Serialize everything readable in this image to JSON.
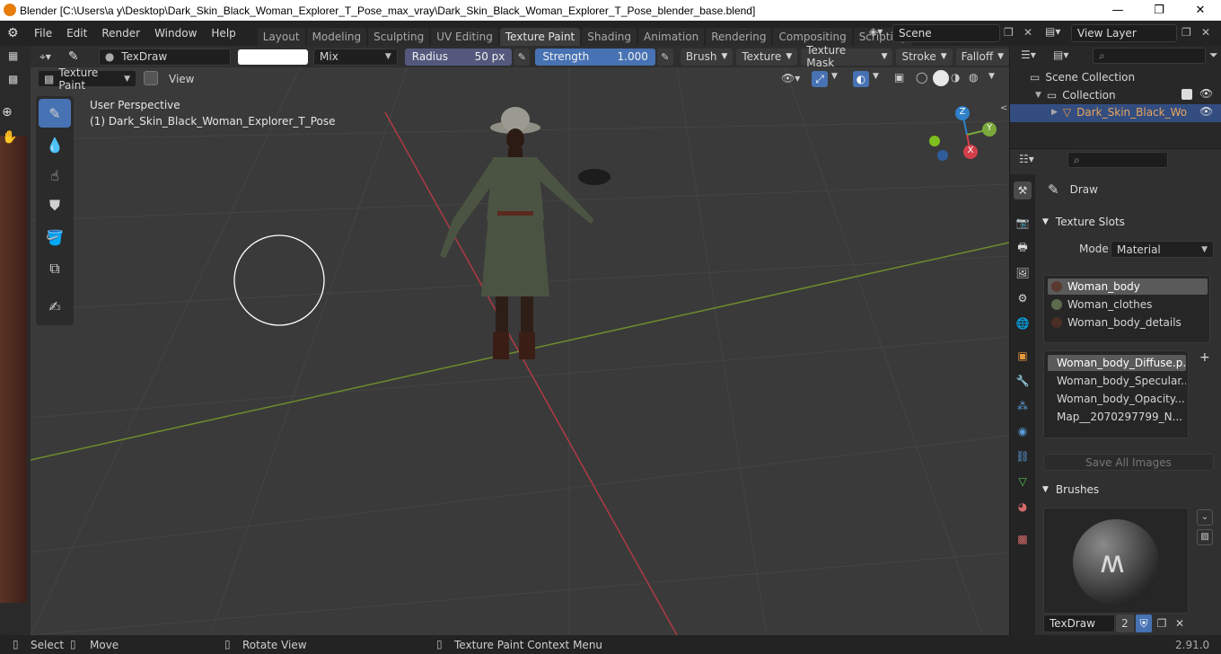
{
  "window": {
    "title": "Blender [C:\\Users\\a y\\Desktop\\Dark_Skin_Black_Woman_Explorer_T_Pose_max_vray\\Dark_Skin_Black_Woman_Explorer_T_Pose_blender_base.blend]",
    "minimize": "—",
    "maximize": "❐",
    "close": "✕"
  },
  "menu": [
    "File",
    "Edit",
    "Render",
    "Window",
    "Help"
  ],
  "workspaces": [
    "Layout",
    "Modeling",
    "Sculpting",
    "UV Editing",
    "Texture Paint",
    "Shading",
    "Animation",
    "Rendering",
    "Compositing",
    "Scripting"
  ],
  "active_workspace": "Texture Paint",
  "add_workspace": "+",
  "scene": {
    "name": "Scene"
  },
  "view_layer": {
    "name": "View Layer"
  },
  "tool_header": {
    "brush_name": "TexDraw",
    "blend_mode": "Mix",
    "radius_label": "Radius",
    "radius_value": "50 px",
    "strength_label": "Strength",
    "strength_value": "1.000",
    "strength_fraction": 1.0,
    "menus": [
      "Brush",
      "Texture",
      "Texture Mask",
      "Stroke",
      "Falloff"
    ]
  },
  "mode_header": {
    "mode": "Texture Paint",
    "view_menu": "View"
  },
  "viewport": {
    "perspective": "User Perspective",
    "object_label": "(1) Dark_Skin_Black_Woman_Explorer_T_Pose",
    "gizmo": {
      "z": "Z",
      "y": "Y",
      "x": "X"
    }
  },
  "outliner": {
    "scene_collection": "Scene Collection",
    "collection": "Collection",
    "object": "Dark_Skin_Black_Wo"
  },
  "properties": {
    "active_tool": "Draw",
    "texture_slots_header": "Texture Slots",
    "mode_label": "Mode",
    "mode_value": "Material",
    "materials": [
      {
        "name": "Woman_body",
        "color": "#5a3a2e"
      },
      {
        "name": "Woman_clothes",
        "color": "#5e6a4e"
      },
      {
        "name": "Woman_body_details",
        "color": "#4a2e26"
      }
    ],
    "images": [
      {
        "name": "Woman_body_Diffuse.p...",
        "color": "#6b4536"
      },
      {
        "name": "Woman_body_Specular...",
        "color": "#8a8a8a"
      },
      {
        "name": "Woman_body_Opacity....",
        "color": "#f2f2f2"
      },
      {
        "name": "Map__2070297799_N...",
        "color": "#b7b2f0"
      }
    ],
    "save_all": "Save All Images",
    "brushes_header": "Brushes",
    "brush_name": "TexDraw",
    "brush_users": "2"
  },
  "status": {
    "select": "Select",
    "move": "Move",
    "rotate": "Rotate View",
    "context": "Texture Paint Context Menu",
    "version": "2.91.0"
  }
}
